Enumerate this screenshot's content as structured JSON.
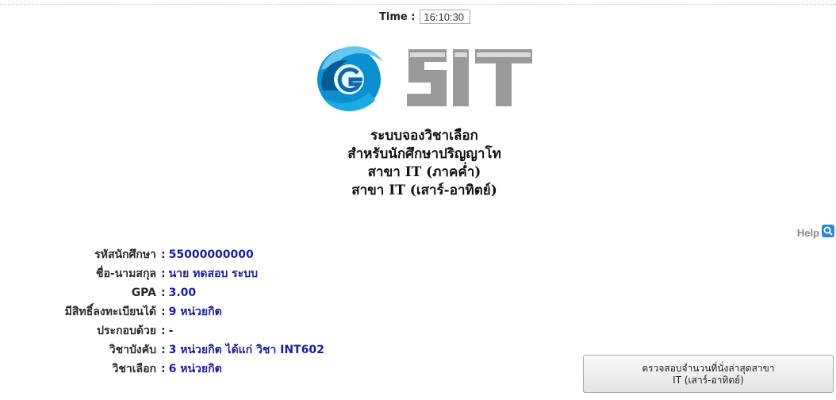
{
  "time": {
    "label": "Time :",
    "value": "16:10:30"
  },
  "logo": {
    "text": "SIT"
  },
  "titles": [
    "ระบบจองวิชาเลือก",
    "สำหรับนักศึกษาปริญญาโท",
    "สาขา IT (ภาคค่ำ)",
    "สาขา IT (เสาร์-อาทิตย์)"
  ],
  "help": {
    "label": "Help",
    "icon": "search-icon"
  },
  "student": {
    "rows": [
      {
        "label": "รหัสนักศึกษา",
        "value": "55000000000"
      },
      {
        "label": "ชื่อ-นามสกุล",
        "value": "นาย ทดสอบ ระบบ"
      },
      {
        "label": "GPA",
        "value": "3.00"
      },
      {
        "label": "มีสิทธิ์ลงทะเบียนได้",
        "value": "9 หน่วยกิต"
      },
      {
        "label": "ประกอบด้วย",
        "value": "-"
      },
      {
        "label": "วิชาบังคับ",
        "value": "3 หน่วยกิต ได้แก่ วิชา INT602"
      },
      {
        "label": "วิชาเลือก",
        "value": "6 หน่วยกิต"
      }
    ]
  },
  "check_button": {
    "line1": "ตรวจสอบจำนวนที่นั่งล่าสุดสาขา",
    "line2": "IT (เสาร์-อาทิตย์)"
  }
}
